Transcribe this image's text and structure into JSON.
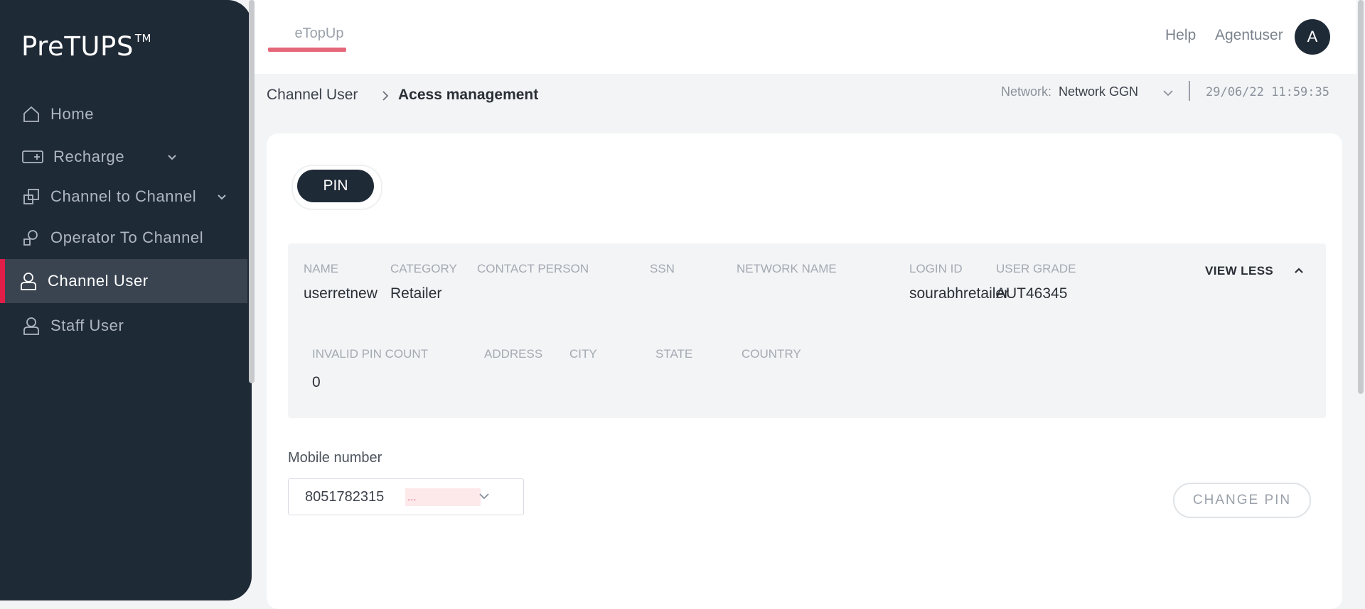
{
  "app": {
    "logo": "PreTUPS",
    "logo_tm": "TM"
  },
  "sidebar": {
    "items": [
      {
        "label": "Home",
        "icon": "home-icon",
        "expandable": false,
        "active": false
      },
      {
        "label": "Recharge",
        "icon": "recharge-icon",
        "expandable": true,
        "active": false
      },
      {
        "label": "Channel to Channel",
        "icon": "channel-transfer-icon",
        "expandable": true,
        "active": false
      },
      {
        "label": "Operator To Channel",
        "icon": "operator-icon",
        "expandable": false,
        "active": false
      },
      {
        "label": "Channel User",
        "icon": "user-icon",
        "expandable": false,
        "active": true
      },
      {
        "label": "Staff User",
        "icon": "user-icon",
        "expandable": false,
        "active": false
      }
    ]
  },
  "header": {
    "tab": "eTopUp",
    "help": "Help",
    "username": "Agentuser",
    "avatar_initial": "A"
  },
  "breadcrumb": {
    "parent": "Channel User",
    "current": "Acess management"
  },
  "network": {
    "label": "Network:",
    "value": "Network GGN"
  },
  "datetime": "29/06/22 11:59:35",
  "pin_tab": "PIN",
  "details": {
    "row1": {
      "headers": [
        "NAME",
        "CATEGORY",
        "CONTACT PERSON",
        "SSN",
        "NETWORK NAME",
        "LOGIN ID",
        "USER GRADE"
      ],
      "values": [
        "userretnew",
        "Retailer",
        "",
        "",
        "",
        "sourabhretailer",
        "AUT46345"
      ]
    },
    "row2": {
      "headers": [
        "INVALID PIN COUNT",
        "ADDRESS",
        "CITY",
        "STATE",
        "COUNTRY"
      ],
      "values": [
        "0",
        "",
        "",
        "",
        ""
      ]
    },
    "toggle_label": "VIEW LESS"
  },
  "mobile": {
    "label": "Mobile number",
    "value": "8051782315",
    "masked": "..."
  },
  "change_pin_label": "CHANGE PIN",
  "colors": {
    "sidebar_bg": "#1f2a37",
    "accent": "#e11d48",
    "tab_underline": "#e5677a"
  }
}
